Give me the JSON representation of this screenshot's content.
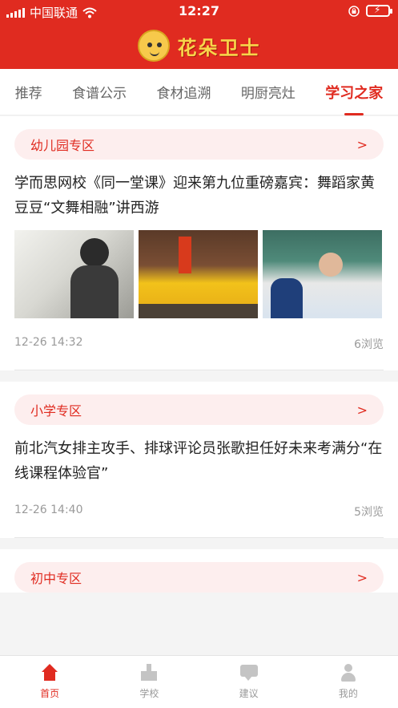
{
  "status": {
    "carrier": "中国联通",
    "time": "12:27",
    "wifi_icon": "wifi-icon",
    "lock_icon": "orientation-lock-icon",
    "battery_icon": "battery-charging-icon"
  },
  "header": {
    "logo_icon": "mascot-logo-icon",
    "app_title": "花朵卫士"
  },
  "tabs": [
    {
      "label": "推荐",
      "active": false
    },
    {
      "label": "食谱公示",
      "active": false
    },
    {
      "label": "食材追溯",
      "active": false
    },
    {
      "label": "明厨亮灶",
      "active": false
    },
    {
      "label": "学习之家",
      "active": true
    }
  ],
  "cards": [
    {
      "zone": "幼儿园专区",
      "chevron": ">",
      "title": "学而思网校《同一堂课》迎来第九位重磅嘉宾：舞蹈家黄豆豆“文舞相融”讲西游",
      "date": "12-26 14:32",
      "views": "6浏览",
      "has_images": true
    },
    {
      "zone": "小学专区",
      "chevron": ">",
      "title": "前北汽女排主攻手、排球评论员张歌担任好未来考满分“在线课程体验官”",
      "date": "12-26 14:40",
      "views": "5浏览",
      "has_images": false
    },
    {
      "zone": "初中专区",
      "chevron": ">"
    }
  ],
  "nav": [
    {
      "label": "首页",
      "icon": "home-icon",
      "active": true
    },
    {
      "label": "学校",
      "icon": "school-icon",
      "active": false
    },
    {
      "label": "建议",
      "icon": "chat-icon",
      "active": false
    },
    {
      "label": "我的",
      "icon": "user-icon",
      "active": false
    }
  ],
  "colors": {
    "brand_red": "#e02b20",
    "zone_bg": "#fdeeee",
    "logo_yellow": "#f7d54a"
  }
}
